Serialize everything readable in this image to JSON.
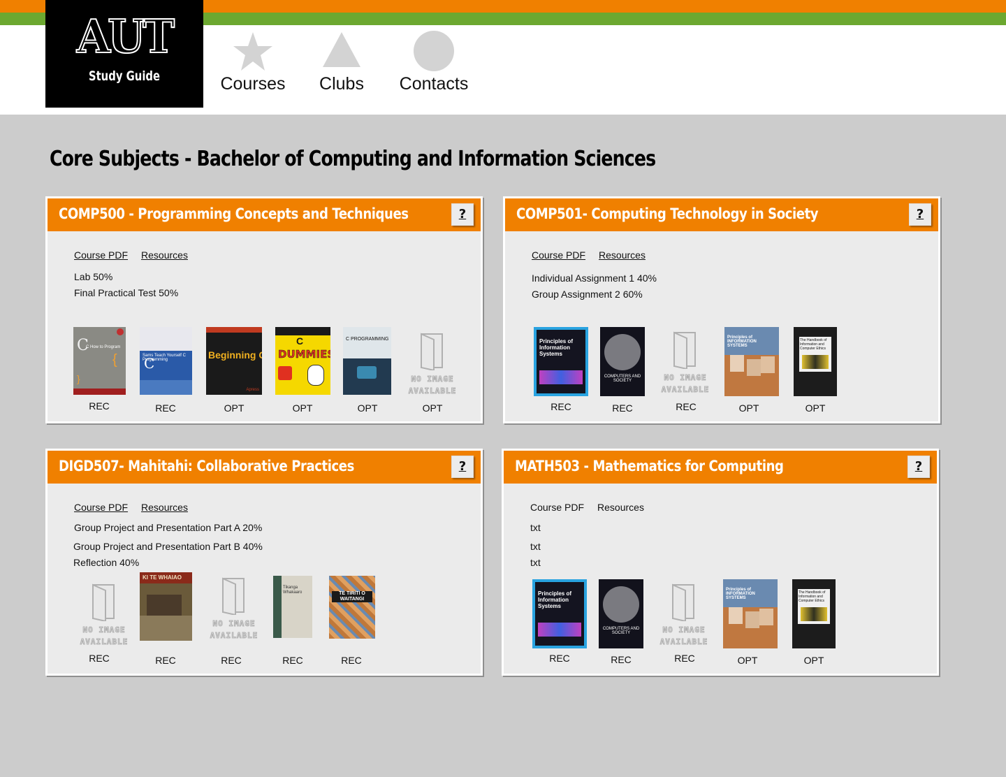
{
  "brand": {
    "logo_text": "AUT",
    "logo_sub": "Study Guide"
  },
  "nav": [
    {
      "label": "Courses",
      "icon": "star-icon"
    },
    {
      "label": "Clubs",
      "icon": "triangle-icon"
    },
    {
      "label": "Contacts",
      "icon": "circle-icon"
    }
  ],
  "page_title": "Core Subjects - Bachelor of Computing and Information Sciences",
  "colors": {
    "orange": "#f08000",
    "green": "#6ca830",
    "background": "#cccccc"
  },
  "cards": [
    {
      "title": "COMP500 - Programming Concepts and Techniques",
      "help": "?",
      "course_pdf": "Course PDF",
      "resources": "Resources",
      "assessments": [
        "Lab 50%",
        "Final Practical Test 50%"
      ],
      "books": [
        {
          "label": "REC",
          "cover": "c-how-to-program",
          "cover_text": "C How to Program"
        },
        {
          "label": "REC",
          "cover": "teach-yourself-c",
          "cover_text": "Sams Teach Yourself C Programming"
        },
        {
          "label": "OPT",
          "cover": "beginning-c",
          "cover_text": "Beginning C"
        },
        {
          "label": "OPT",
          "cover": "c-for-dummies",
          "cover_text": "DUMMIES"
        },
        {
          "label": "OPT",
          "cover": "c-programming-learn",
          "cover_text": "C PROGRAMMING"
        },
        {
          "label": "OPT",
          "cover": "no-image",
          "cover_text": "NO IMAGE AVAILABLE"
        }
      ]
    },
    {
      "title": "COMP501- Computing Technology in Society",
      "help": "?",
      "course_pdf": "Course PDF",
      "resources": "Resources",
      "assessments": [
        "Individual Assignment 1 40%",
        "Group Assignment 2 60%"
      ],
      "books": [
        {
          "label": "REC",
          "cover": "principles-info-systems",
          "cover_text": "Principles of Information Systems"
        },
        {
          "label": "REC",
          "cover": "computers-and-society",
          "cover_text": "COMPUTERS AND SOCIETY"
        },
        {
          "label": "REC",
          "cover": "no-image",
          "cover_text": "NO IMAGE AVAILABLE"
        },
        {
          "label": "OPT",
          "cover": "principles-info-systems-2",
          "cover_text": "Principles of INFORMATION SYSTEMS"
        },
        {
          "label": "OPT",
          "cover": "handbook-computer-ethics",
          "cover_text": "The Handbook of Information and Computer Ethics"
        }
      ]
    },
    {
      "title": "DIGD507- Mahitahi: Collaborative Practices",
      "help": "?",
      "course_pdf": "Course PDF",
      "resources": "Resources",
      "assessments": [
        "Group Project and Presentation Part A 20%",
        "Group Project and Presentation Part B 40%",
        "Reflection 40%"
      ],
      "books": [
        {
          "label": "REC",
          "cover": "no-image",
          "cover_text": "NO IMAGE AVAILABLE"
        },
        {
          "label": "REC",
          "cover": "ki-te-whaiao",
          "cover_text": "KI TE WHAIAO"
        },
        {
          "label": "REC",
          "cover": "no-image",
          "cover_text": "NO IMAGE AVAILABLE"
        },
        {
          "label": "REC",
          "cover": "tikanga-whakaaro",
          "cover_text": "Tikanga Whakaaro"
        },
        {
          "label": "REC",
          "cover": "te-tiriti-o-waitangi",
          "cover_text": "TE TIRITI O WAITANGI"
        }
      ]
    },
    {
      "title": "MATH503 - Mathematics for Computing",
      "help": "?",
      "course_pdf": "Course PDF",
      "resources": "Resources",
      "assessments": [
        "txt",
        "txt",
        "txt"
      ],
      "books": [
        {
          "label": "REC",
          "cover": "principles-info-systems",
          "cover_text": "Principles of Information Systems"
        },
        {
          "label": "REC",
          "cover": "computers-and-society",
          "cover_text": "COMPUTERS AND SOCIETY"
        },
        {
          "label": "REC",
          "cover": "no-image",
          "cover_text": "NO IMAGE AVAILABLE"
        },
        {
          "label": "OPT",
          "cover": "principles-info-systems-2",
          "cover_text": "Principles of INFORMATION SYSTEMS"
        },
        {
          "label": "OPT",
          "cover": "handbook-computer-ethics",
          "cover_text": "The Handbook of Information and Computer Ethics"
        }
      ]
    }
  ]
}
